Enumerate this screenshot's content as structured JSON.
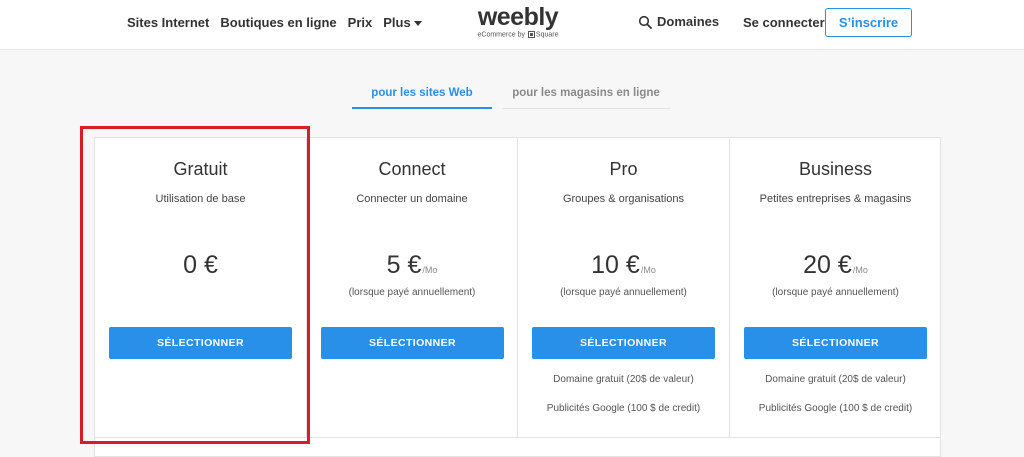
{
  "header": {
    "nav": [
      "Sites Internet",
      "Boutiques en ligne",
      "Prix",
      "Plus"
    ],
    "logo_word": "weebly",
    "logo_sub_prefix": "eCommerce by",
    "logo_sub_brand": "Square",
    "domains": "Domaines",
    "login": "Se connecter",
    "signup": "S’inscrire"
  },
  "tabs": {
    "web": "pour les sites Web",
    "store": "pour les magasins en ligne"
  },
  "colors": {
    "accent": "#2990ea",
    "highlight": "#d41f2b"
  },
  "plans": [
    {
      "name": "Gratuit",
      "desc": "Utilisation de base",
      "price": "0 €",
      "per": "",
      "note": "",
      "button": "SÉLECTIONNER",
      "features": []
    },
    {
      "name": "Connect",
      "desc": "Connecter un domaine",
      "price": "5 €",
      "per": "/Mo",
      "note": "(lorsque payé annuellement)",
      "button": "SÉLECTIONNER",
      "features": []
    },
    {
      "name": "Pro",
      "desc": "Groupes & organisations",
      "price": "10 €",
      "per": "/Mo",
      "note": "(lorsque payé annuellement)",
      "button": "SÉLECTIONNER",
      "features": [
        "Domaine gratuit (20$ de valeur)",
        "Publicités Google (100 $ de credit)"
      ]
    },
    {
      "name": "Business",
      "desc": "Petites entreprises & magasins",
      "price": "20 €",
      "per": "/Mo",
      "note": "(lorsque payé annuellement)",
      "button": "SÉLECTIONNER",
      "features": [
        "Domaine gratuit (20$ de valeur)",
        "Publicités Google (100 $ de credit)"
      ]
    }
  ]
}
